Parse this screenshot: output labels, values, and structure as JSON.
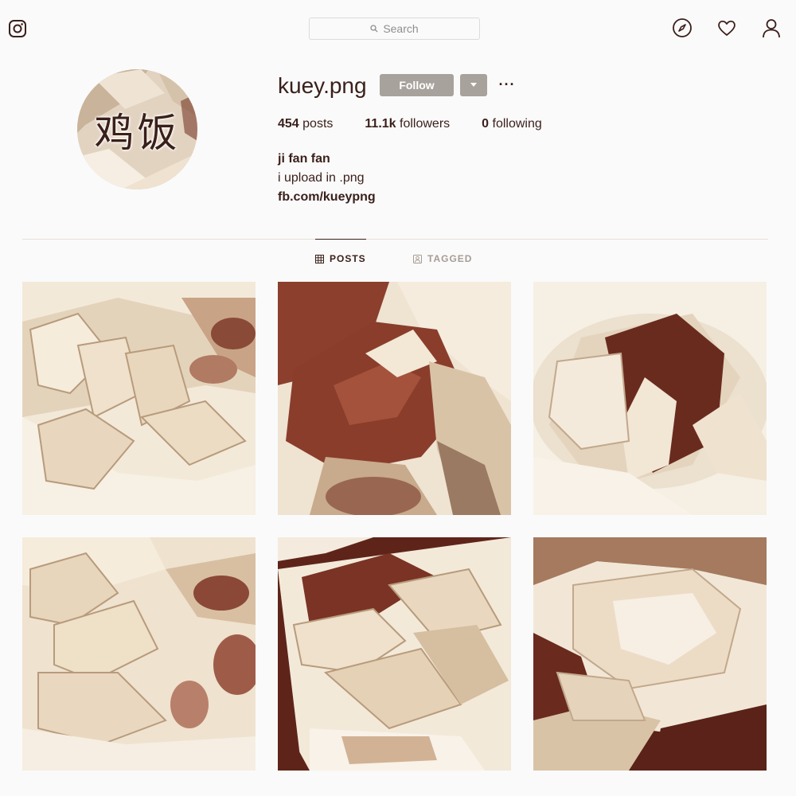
{
  "nav": {
    "logo_icon": "instagram-icon",
    "search_placeholder": "Search",
    "icons": [
      "explore-compass-icon",
      "heart-icon",
      "profile-icon"
    ]
  },
  "profile": {
    "avatar_text": "鸡饭",
    "username": "kuey.png",
    "follow_label": "Follow",
    "dropdown_icon": "chevron-down-icon",
    "more_label": "···",
    "stats": [
      {
        "count": "454",
        "label": "posts"
      },
      {
        "count": "11.1k",
        "label": "followers"
      },
      {
        "count": "0",
        "label": "following"
      }
    ],
    "bio": {
      "name": "ji fan fan",
      "text": "i upload in .png",
      "link": "fb.com/kueypng"
    }
  },
  "tabs": [
    {
      "label": "POSTS",
      "icon": "grid-icon",
      "active": true
    },
    {
      "label": "TAGGED",
      "icon": "tag-user-icon",
      "active": false
    }
  ],
  "colors": {
    "text": "#3a1f1a",
    "button": "#a8a29c",
    "background": "#fafafa",
    "photo_dark": "#6b2a1e",
    "photo_light": "#f3e9d9"
  }
}
